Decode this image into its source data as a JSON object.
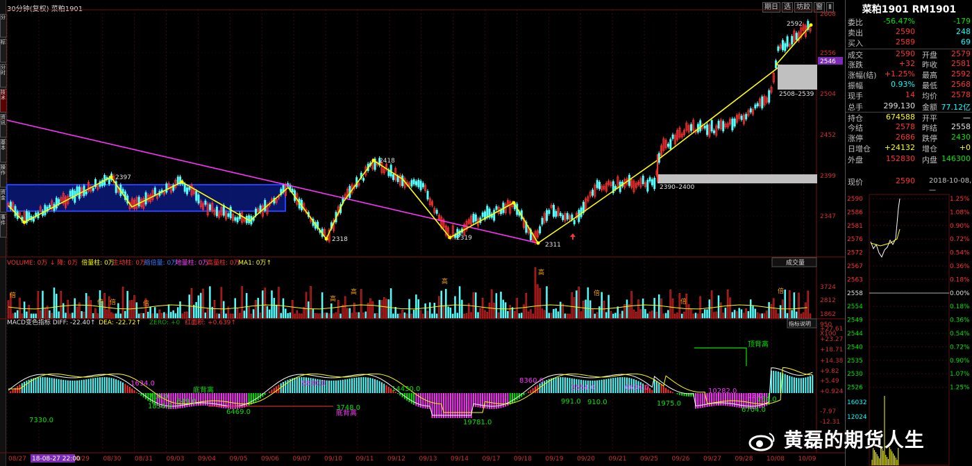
{
  "header": {
    "title": "30分钟(复权)  菜粕1901"
  },
  "top_buttons": [
    "期日",
    "选",
    "坊跤",
    "窗",
    "Ⅱ"
  ],
  "left_tabs": [
    "分",
    "标",
    "分时",
    "技术",
    "资讯",
    "基本",
    "操作",
    "资金",
    "事件"
  ],
  "price_axis": [
    "2608",
    "2556",
    "2546",
    "2504",
    "2452",
    "2399",
    "2347"
  ],
  "annotations": {
    "p2397": "2397",
    "p2418": "2418",
    "p2318": "2318",
    "p2319": "2319",
    "p2311": "2311",
    "p2592": "2592",
    "zone_upper": "2508–2539",
    "zone_lower": "2390–2400"
  },
  "volume_legend": [
    {
      "text": "VOLUME: 0万",
      "color": "#ff3232"
    },
    {
      "text": "↓ 降: 0万",
      "color": "#ff3232"
    },
    {
      "text": "倍量柱: 0万",
      "color": "#ffff00"
    },
    {
      "text": "主动柱: 0万",
      "color": "#ff3232"
    },
    {
      "text": "缩倍量: 0万",
      "color": "#3c78ff"
    },
    {
      "text": "地量柱: 0万",
      "color": "#ff40ff"
    },
    {
      "text": "高量柱: 0万",
      "color": "#ff3232"
    },
    {
      "text": "MA1: 0万↑",
      "color": "#ffff00"
    }
  ],
  "volume_button": "成交量",
  "volume_axis": [
    "3724",
    "2812",
    "1862",
    "950",
    "X100"
  ],
  "volume_marks": {
    "gao": "高",
    "bei": "倍"
  },
  "macd_legend": [
    {
      "text": "MACD变色指标  DIFF: -22.40↑",
      "color": "#e0e0e0"
    },
    {
      "text": "DEA: -22.72↑",
      "color": "#ffff00"
    },
    {
      "text": "ZERO: +0",
      "color": "#00aa00"
    },
    {
      "text": "红面积: +0.639↑",
      "color": "#ff3232"
    }
  ],
  "macd_button": "指标说明",
  "macd_axis": [
    "+27.61",
    "+23.27",
    "+18.71",
    "+14.38",
    "+9.82",
    "+5.49",
    "+0.924",
    "-7.97",
    "-12.31"
  ],
  "macd_labels": {
    "a7330": "7330.0",
    "a1634": "1634.0",
    "a710": "710.0",
    "a649": "649.0",
    "a1856": "1856.0",
    "a_dibei": "底背离",
    "a6469": "6469.0",
    "a5830": "5830.0",
    "a3748": "3748.0",
    "a_dibei2": "底背离",
    "a14430": "14430.0",
    "a19781": "19781.0",
    "a8360": "8360.0",
    "a991": "991.0",
    "a3554": "3554.0",
    "a910": "910.0",
    "a6634": "6634.0",
    "a1975": "1975.0",
    "a10282": "10282.0",
    "a92": "92.0",
    "a134": "134.0",
    "a6704": "6704.0",
    "a_dingbei": "顶背离"
  },
  "dates": [
    "08/27",
    "08/28",
    "08/29",
    "08/30",
    "08/31",
    "09/03",
    "09/04",
    "09/05",
    "09/06",
    "09/07",
    "09/10",
    "09/11",
    "09/12",
    "09/13",
    "09/14",
    "09/17",
    "09/18",
    "09/19",
    "09/20",
    "09/21",
    "09/25",
    "09/26",
    "09/27",
    "09/28",
    "10/08",
    "10/09"
  ],
  "date_highlight": "18-08-27 22:00",
  "quote": {
    "title": "菜粕1901 RM1901",
    "rows": [
      {
        "l": "委比",
        "v": "-56.47%",
        "vc": "green",
        "l2": "",
        "v2": "-179",
        "v2c": "green"
      },
      {
        "l": "卖出",
        "v": "2590",
        "vc": "red",
        "l2": "",
        "v2": "248",
        "v2c": "cyan"
      },
      {
        "l": "买入",
        "v": "2589",
        "vc": "red",
        "l2": "",
        "v2": "69",
        "v2c": "cyan"
      },
      {
        "l": "成交",
        "v": "2590",
        "vc": "red",
        "l2": "开盘",
        "v2": "2579",
        "v2c": "red"
      },
      {
        "l": "涨跌",
        "v": "+32",
        "vc": "red",
        "l2": "昨收",
        "v2": "2581",
        "v2c": "red"
      },
      {
        "l": "涨幅(结)",
        "v": "+1.25%",
        "vc": "red",
        "l2": "最高",
        "v2": "2592",
        "v2c": "red"
      },
      {
        "l": "振幅",
        "v": "0.93%",
        "vc": "cyan",
        "l2": "最低",
        "v2": "2568",
        "v2c": "red"
      },
      {
        "l": "现手",
        "v": "14",
        "vc": "red",
        "l2": "均价",
        "v2": "2578",
        "v2c": "red"
      },
      {
        "l": "总手",
        "v": "299,130",
        "vc": "white",
        "l2": "金额",
        "v2": "77.12亿",
        "v2c": "cyan"
      },
      {
        "l": "持仓",
        "v": "674588",
        "vc": "yellow",
        "l2": "开平",
        "v2": "一",
        "v2c": "white"
      },
      {
        "l": "今结",
        "v": "2578",
        "vc": "red",
        "l2": "昨结",
        "v2": "2558",
        "v2c": "white"
      },
      {
        "l": "涨停",
        "v": "2686",
        "vc": "red",
        "l2": "跌停",
        "v2": "2430",
        "v2c": "green"
      },
      {
        "l": "日增仓",
        "v": "+24132",
        "vc": "yellow",
        "l2": "增仓",
        "v2": "+0",
        "v2c": "yellow"
      },
      {
        "l": "外盘",
        "v": "152830",
        "vc": "red",
        "l2": "内盘",
        "v2": "146300",
        "v2c": "green"
      }
    ],
    "now_label": "现价",
    "now_price": "2590",
    "now_time": "2018-10-08,一"
  },
  "mini_chart": {
    "left_axis": [
      "2590",
      "2586",
      "2581",
      "2576",
      "2572",
      "2567",
      "2563",
      "2558",
      "2554",
      "2549",
      "2544",
      "2540",
      "2535",
      "2530",
      "2526"
    ],
    "right_axis": [
      "1.25%",
      "1.08%",
      "0.90%",
      "0.72%",
      "0.54%",
      "0.36%",
      "0.18%",
      "0.00%",
      "0.18%",
      "0.36%",
      "0.54%",
      "0.72%",
      "0.90%",
      "1.07%",
      "1.25%"
    ],
    "vol_axis": [
      "16032",
      "12024"
    ]
  },
  "watermark": "黄磊的期货人生"
}
